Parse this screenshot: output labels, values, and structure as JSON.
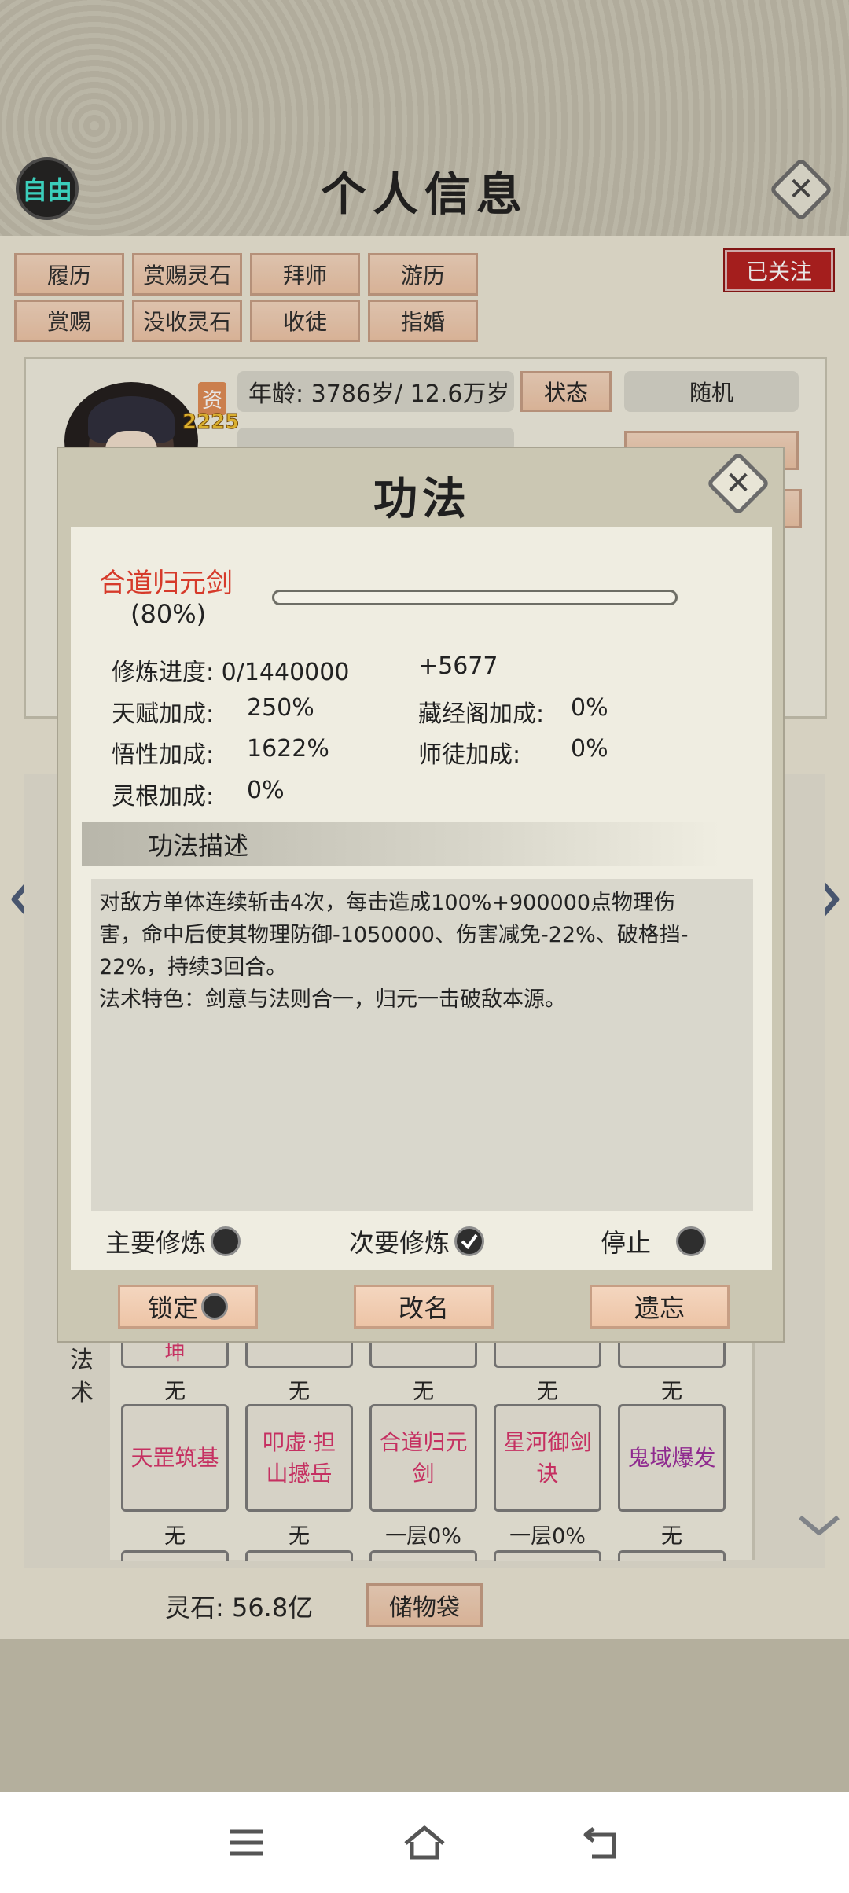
{
  "header": {
    "free_badge": "自由",
    "title": "个人信息",
    "followed_label": "已关注"
  },
  "actions": {
    "row1": [
      "履历",
      "赏赐灵石",
      "拜师",
      "游历"
    ],
    "row2": [
      "赏赐",
      "没收灵石",
      "收徒",
      "指婚"
    ]
  },
  "profile": {
    "zi_tag": "资",
    "zi_value": "2225",
    "age_text": "年龄: 3786岁/ 12.6万岁",
    "status_button": "状态",
    "random_button": "随机"
  },
  "skill_grid": {
    "section_label": "法术",
    "top_partial_cell": "坤",
    "row1_status": [
      "无",
      "无",
      "无",
      "无",
      "无"
    ],
    "cells": [
      {
        "name": "天罡筑基",
        "color": "#d93069"
      },
      {
        "name": "叩虚·担山撼岳",
        "color": "#d93069"
      },
      {
        "name": "合道归元剑",
        "color": "#d93069"
      },
      {
        "name": "星河御剑诀",
        "color": "#d93069"
      },
      {
        "name": "鬼域爆发",
        "color": "#9b2a9e"
      }
    ],
    "row2_status": [
      "无",
      "无",
      "一层0%",
      "一层0%",
      "无"
    ]
  },
  "footer": {
    "spirit_stone": "灵石: 56.8亿",
    "bag_button": "储物袋"
  },
  "modal": {
    "title": "功法",
    "skill_name": "合道归元剑",
    "skill_percent": "(80%)",
    "progress_fraction": 0.0,
    "stats": {
      "cultivation_progress": "修炼进度: 0/1440000",
      "cultivation_gain": "+5677",
      "talent_bonus_label": "天赋加成:",
      "talent_bonus_value": "250%",
      "library_bonus_label": "藏经阁加成:",
      "library_bonus_value": "0%",
      "comprehension_bonus_label": "悟性加成:",
      "comprehension_bonus_value": "1622%",
      "master_bonus_label": "师徒加成:",
      "master_bonus_value": "0%",
      "root_bonus_label": "灵根加成:",
      "root_bonus_value": "0%"
    },
    "description_header": "功法描述",
    "description_line1": "对敌方单体连续斩击4次，每击造成100%+900000点物理伤",
    "description_line2": "害，命中后使其物理防御-1050000、伤害减免-22%、破格挡-",
    "description_line3": "22%，持续3回合。",
    "description_line4": "法术特色：剑意与法则合一，归元一击破敌本源。",
    "options": {
      "primary": "主要修炼",
      "secondary": "次要修炼",
      "stop": "停止",
      "selected": "secondary"
    },
    "buttons": {
      "lock": "锁定",
      "rename": "改名",
      "forget": "遗忘"
    }
  }
}
